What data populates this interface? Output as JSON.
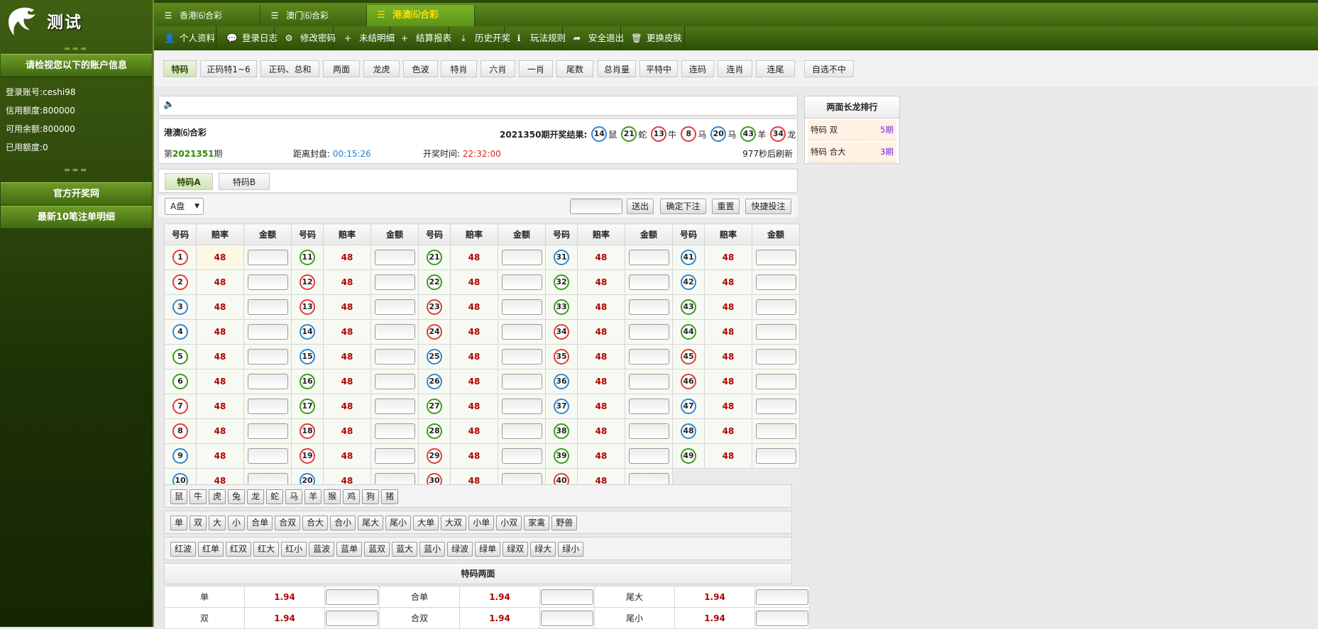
{
  "app": {
    "title": "测试"
  },
  "sidebar": {
    "notice": "请检视您以下的账户信息",
    "account": [
      {
        "label": "登录账号:",
        "value": "ceshi98"
      },
      {
        "label": "信用额度:",
        "value": "800000"
      },
      {
        "label": "可用余额:",
        "value": "800000"
      },
      {
        "label": "已用额度:",
        "value": "0"
      }
    ],
    "links": [
      "官方开奖网",
      "最新10笔注单明细"
    ]
  },
  "top_tabs": [
    "香港⑹合彩",
    "澳门⑹合彩",
    "港澳⑹合彩"
  ],
  "menu": [
    {
      "icon": "user-icon",
      "label": "个人资料"
    },
    {
      "icon": "chat-icon",
      "label": "登录日志"
    },
    {
      "icon": "gear-icon",
      "label": "修改密码"
    },
    {
      "icon": "plus-icon",
      "label": "未结明细"
    },
    {
      "icon": "plus-icon",
      "label": "结算报表"
    },
    {
      "icon": "history-icon",
      "label": "历史开奖"
    },
    {
      "icon": "info-icon",
      "label": "玩法规则"
    },
    {
      "icon": "logout-icon",
      "label": "安全退出"
    },
    {
      "icon": "trash-icon",
      "label": "更换皮肤"
    }
  ],
  "category_tabs": [
    "特码",
    "正码特1~6",
    "正码、总和",
    "两面",
    "龙虎",
    "色波",
    "特肖",
    "六肖",
    "一肖",
    "尾数",
    "总肖量",
    "平特中",
    "连码",
    "连肖",
    "连尾",
    "自选不中"
  ],
  "game": {
    "name": "港澳⑹合彩",
    "result_label": "2021350期开奖结果:",
    "results": [
      {
        "num": "14",
        "zodiac": "鼠",
        "color": "blue"
      },
      {
        "num": "21",
        "zodiac": "蛇",
        "color": "green"
      },
      {
        "num": "13",
        "zodiac": "牛",
        "color": "red"
      },
      {
        "num": "8",
        "zodiac": "马",
        "color": "red"
      },
      {
        "num": "20",
        "zodiac": "马",
        "color": "blue"
      },
      {
        "num": "43",
        "zodiac": "羊",
        "color": "green"
      },
      {
        "num": "34",
        "zodiac": "龙",
        "color": "red"
      }
    ],
    "period_prefix": "第",
    "period": "2021351",
    "period_suffix": "期",
    "close_label": "距离封盘:",
    "close_time": "00:15:26",
    "draw_label": "开奖时间:",
    "draw_time": "22:32:00",
    "refresh": "977秒后刷新"
  },
  "sub_tabs": [
    "特码A",
    "特码B"
  ],
  "toolbar": {
    "plate": "A盘",
    "send": "送出",
    "confirm": "确定下注",
    "reset": "重置",
    "quick": "快捷投注"
  },
  "grid": {
    "headers": [
      "号码",
      "赔率",
      "金额"
    ],
    "odds": "48"
  },
  "zodiacs": [
    "鼠",
    "牛",
    "虎",
    "兔",
    "龙",
    "蛇",
    "马",
    "羊",
    "猴",
    "鸡",
    "狗",
    "猪"
  ],
  "quick_row2": [
    "单",
    "双",
    "大",
    "小",
    "合单",
    "合双",
    "合大",
    "合小",
    "尾大",
    "尾小",
    "大单",
    "大双",
    "小单",
    "小双",
    "家禽",
    "野兽"
  ],
  "quick_row3": [
    "红波",
    "红单",
    "红双",
    "红大",
    "红小",
    "蓝波",
    "蓝单",
    "蓝双",
    "蓝大",
    "蓝小",
    "绿波",
    "绿单",
    "绿双",
    "绿大",
    "绿小"
  ],
  "two_sides": {
    "title": "特码两面",
    "rows": [
      [
        {
          "label": "单",
          "odds": "1.94"
        },
        {
          "label": "合单",
          "odds": "1.94"
        },
        {
          "label": "尾大",
          "odds": "1.94"
        }
      ],
      [
        {
          "label": "双",
          "odds": "1.94"
        },
        {
          "label": "合双",
          "odds": "1.94"
        },
        {
          "label": "尾小",
          "odds": "1.94"
        }
      ]
    ]
  },
  "ranking": {
    "title": "两面长龙排行",
    "items": [
      {
        "label": "特码 双",
        "value": "5期"
      },
      {
        "label": "特码 合大",
        "value": "3期"
      }
    ]
  },
  "colors": {
    "red_balls": [
      1,
      2,
      7,
      8,
      12,
      13,
      18,
      19,
      23,
      24,
      29,
      30,
      34,
      35,
      40,
      45,
      46
    ],
    "blue_balls": [
      3,
      4,
      9,
      10,
      14,
      15,
      20,
      25,
      26,
      31,
      36,
      37,
      41,
      42,
      47,
      48
    ],
    "green_balls": [
      5,
      6,
      11,
      16,
      17,
      21,
      22,
      27,
      28,
      32,
      33,
      38,
      39,
      43,
      44,
      49
    ]
  }
}
